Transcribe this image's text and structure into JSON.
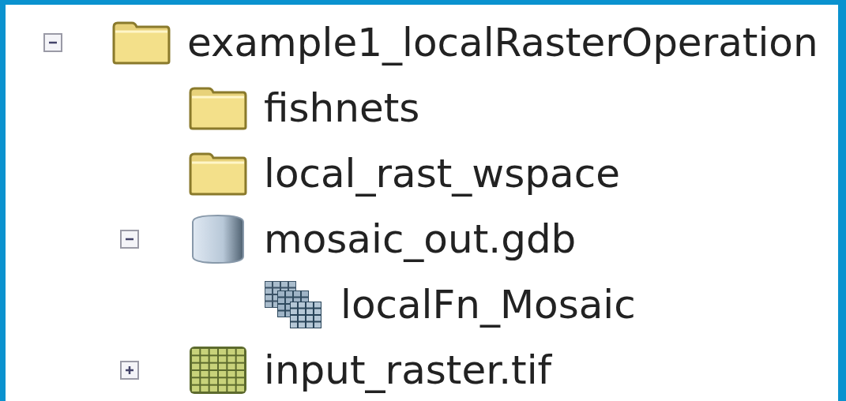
{
  "tree": [
    {
      "kind": "folder",
      "label": "example1_localRasterOperation",
      "expanded": true,
      "children": [
        {
          "kind": "folder",
          "label": "fishnets"
        },
        {
          "kind": "folder",
          "label": "local_rast_wspace"
        },
        {
          "kind": "geodatabase",
          "label": "mosaic_out.gdb",
          "expanded": true,
          "children": [
            {
              "kind": "mosaic",
              "label": "localFn_Mosaic"
            }
          ]
        },
        {
          "kind": "raster",
          "label": "input_raster.tif",
          "expanded": false
        }
      ]
    }
  ]
}
